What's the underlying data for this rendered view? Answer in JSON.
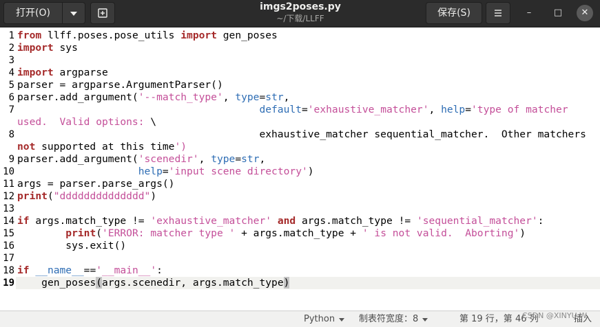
{
  "header": {
    "open_label": "打开(O)",
    "open_menu_icon": "chevron-down-icon",
    "new_tab_icon": "new-document-icon",
    "title": "imgs2poses.py",
    "subtitle": "~/下载/LLFF",
    "save_label": "保存(S)",
    "menu_icon": "hamburger-menu-icon",
    "minimize_glyph": "–",
    "maximize_glyph": "□",
    "close_glyph": "✕"
  },
  "editor": {
    "current_line": 19,
    "lines": [
      {
        "num": "1",
        "code": "from llff.poses.pose_utils import gen_poses"
      },
      {
        "num": "2",
        "code": "import sys"
      },
      {
        "num": "3",
        "code": ""
      },
      {
        "num": "4",
        "code": "import argparse"
      },
      {
        "num": "5",
        "code": "parser = argparse.ArgumentParser()"
      },
      {
        "num": "6",
        "code": "parser.add_argument('--match_type', type=str,"
      },
      {
        "num": "7",
        "code": "                                        default='exhaustive_matcher', help='type of matcher used.  Valid options: \\"
      },
      {
        "num": "8",
        "code": "                                        exhaustive_matcher sequential_matcher.  Other matchers not supported at this time')"
      },
      {
        "num": "9",
        "code": "parser.add_argument('scenedir', type=str,"
      },
      {
        "num": "10",
        "code": "                    help='input scene directory')"
      },
      {
        "num": "11",
        "code": "args = parser.parse_args()"
      },
      {
        "num": "12",
        "code": "print(\"dddddddddddddd\")"
      },
      {
        "num": "13",
        "code": ""
      },
      {
        "num": "14",
        "code": "if args.match_type != 'exhaustive_matcher' and args.match_type != 'sequential_matcher':"
      },
      {
        "num": "15",
        "code": "        print('ERROR: matcher type ' + args.match_type + ' is not valid.  Aborting')"
      },
      {
        "num": "16",
        "code": "        sys.exit()"
      },
      {
        "num": "17",
        "code": ""
      },
      {
        "num": "18",
        "code": "if __name__=='__main__':"
      },
      {
        "num": "19",
        "code": "    gen_poses(args.scenedir, args.match_type)"
      }
    ]
  },
  "statusbar": {
    "language": "Python",
    "tab_width": "制表符宽度：8",
    "cursor_position": "第 19 行，第 46 列",
    "insert_mode": "插入"
  },
  "watermark": "CSDN @XINYU.W",
  "colors": {
    "header_bg": "#2b2b2b",
    "keyword": "#a52a2a",
    "string": "#c44f99",
    "builtin": "#2e6db4",
    "current_line_bg": "#f1f1ee"
  }
}
